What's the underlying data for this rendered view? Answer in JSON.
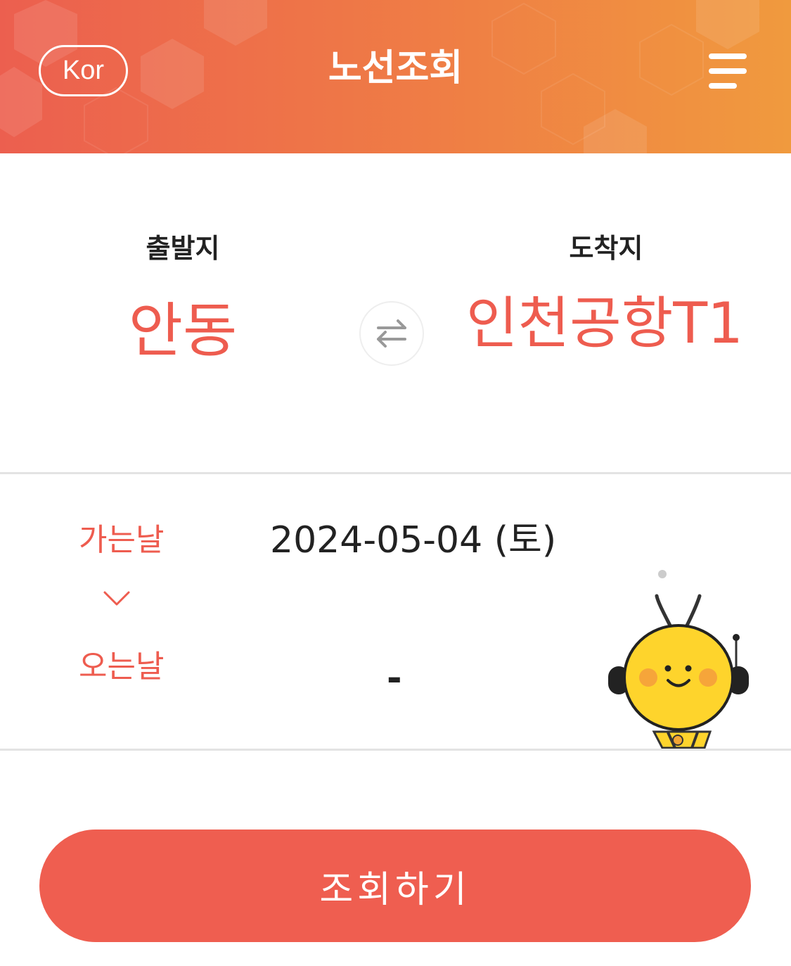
{
  "header": {
    "language_label": "Kor",
    "title": "노선조회"
  },
  "route": {
    "departure_label": "출발지",
    "departure_value": "안동",
    "arrival_label": "도착지",
    "arrival_value": "인천공항T1"
  },
  "dates": {
    "departure_date_label": "가는날",
    "departure_date_value": "2024-05-04 (토)",
    "return_date_label": "오는날",
    "return_date_value": "-"
  },
  "actions": {
    "search_label": "조회하기"
  },
  "colors": {
    "accent": "#ee5c4f",
    "header_gradient_start": "#ec5f4f",
    "header_gradient_end": "#f09a3e",
    "mascot_yellow": "#fed42c"
  },
  "icons": {
    "menu": "hamburger-menu-icon",
    "swap": "swap-arrows-icon",
    "chevron": "chevron-down-icon",
    "mascot": "bee-mascot-icon"
  }
}
